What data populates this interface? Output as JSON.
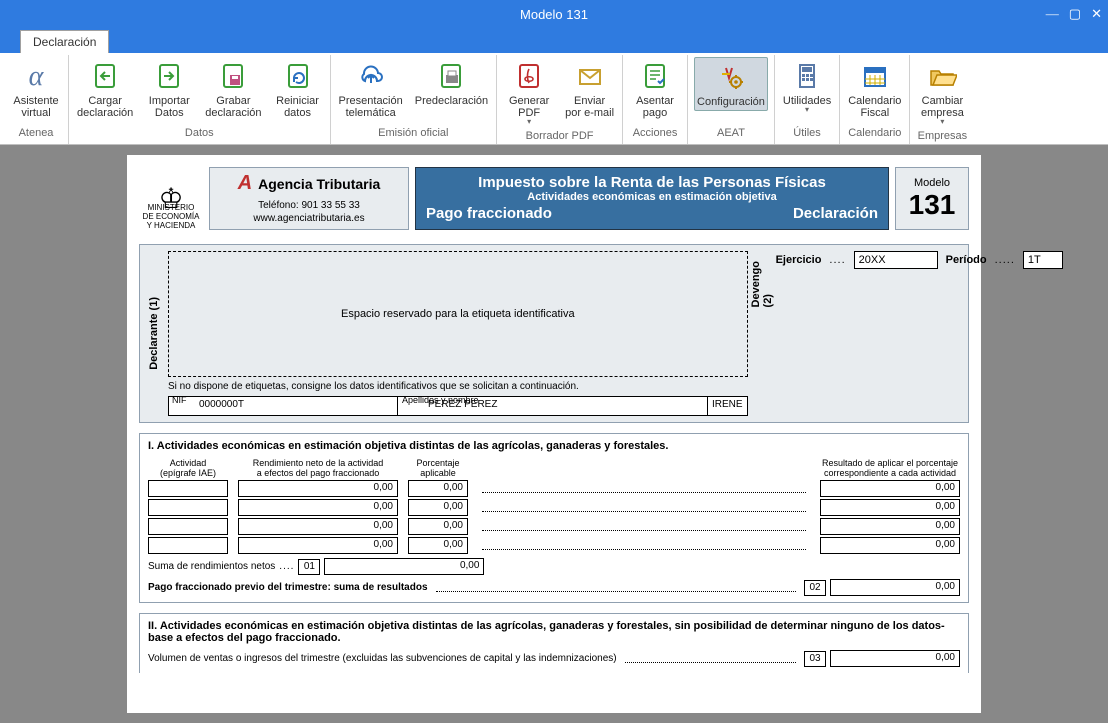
{
  "window": {
    "title": "Modelo 131"
  },
  "tab": {
    "label": "Declaración"
  },
  "ribbon": {
    "groups": [
      {
        "name": "Atenea",
        "items": [
          {
            "label": "Asistente\nvirtual"
          }
        ]
      },
      {
        "name": "Datos",
        "items": [
          {
            "label": "Cargar\ndeclaración"
          },
          {
            "label": "Importar\nDatos"
          },
          {
            "label": "Grabar\ndeclaración"
          },
          {
            "label": "Reiniciar\ndatos"
          }
        ]
      },
      {
        "name": "Emisión oficial",
        "items": [
          {
            "label": "Presentación\ntelemática"
          },
          {
            "label": "Predeclaración"
          }
        ]
      },
      {
        "name": "Borrador PDF",
        "items": [
          {
            "label": "Generar\nPDF",
            "caret": true
          },
          {
            "label": "Enviar\npor e-mail"
          }
        ]
      },
      {
        "name": "Acciones",
        "items": [
          {
            "label": "Asentar\npago"
          }
        ]
      },
      {
        "name": "AEAT",
        "items": [
          {
            "label": "Configuración",
            "active": true
          }
        ]
      },
      {
        "name": "Útiles",
        "items": [
          {
            "label": "Utilidades",
            "caret": true
          }
        ]
      },
      {
        "name": "Calendario",
        "items": [
          {
            "label": "Calendario\nFiscal"
          }
        ]
      },
      {
        "name": "Empresas",
        "items": [
          {
            "label": "Cambiar\nempresa",
            "caret": true
          }
        ]
      }
    ]
  },
  "header": {
    "ministerio": "MINISTERIO\nDE ECONOMÍA\nY HACIENDA",
    "agencia": "Agencia Tributaria",
    "telefono": "Teléfono: 901 33 55 33",
    "web": "www.agenciatributaria.es",
    "irpf_l1": "Impuesto sobre la Renta de las Personas Físicas",
    "irpf_l2": "Actividades económicas en estimación objetiva",
    "irpf_l3a": "Pago fraccionado",
    "irpf_l3b": "Declaración",
    "modelo_label": "Modelo",
    "modelo_num": "131"
  },
  "declarante": {
    "label": "Declarante (1)",
    "etiqueta": "Espacio reservado para la etiqueta identificativa",
    "nota": "Si no dispone de etiquetas, consigne los datos identificativos que se solicitan a continuación.",
    "nif_label": "NIF",
    "nif": "0000000T",
    "apell_label": "Apellidos y nombre",
    "apellidos": "PEREZ PEREZ",
    "nombre": "IRENE"
  },
  "devengo": {
    "label": "Devengo\n(2)",
    "ej_label": "Ejercicio",
    "ej": "20XX",
    "per_label": "Período",
    "per": "1T"
  },
  "sec1": {
    "title": "I.  Actividades económicas en estimación objetiva distintas de las agrícolas, ganaderas y forestales.",
    "col_actividad": "Actividad\n(epígrafe IAE)",
    "col_rend": "Rendimiento neto de la actividad\na efectos del pago fraccionado",
    "col_pct": "Porcentaje\naplicable",
    "col_res": "Resultado de aplicar el porcentaje\ncorrespondiente a cada actividad",
    "rows": [
      {
        "rend": "0,00",
        "pct": "0,00",
        "res": "0,00"
      },
      {
        "rend": "0,00",
        "pct": "0,00",
        "res": "0,00"
      },
      {
        "rend": "0,00",
        "pct": "0,00",
        "res": "0,00"
      },
      {
        "rend": "0,00",
        "pct": "0,00",
        "res": "0,00"
      }
    ],
    "suma_label": "Suma de rendimientos netos",
    "box01": "01",
    "suma_val": "0,00",
    "previo_label": "Pago fraccionado previo del trimestre: suma de resultados",
    "box02": "02",
    "previo_val": "0,00"
  },
  "sec2": {
    "title": "II.  Actividades económicas en estimación objetiva distintas de las agrícolas, ganaderas y forestales, sin posibilidad de determinar ninguno de los datos-base a efectos del pago fraccionado.",
    "vol_label": "Volumen de ventas o ingresos del trimestre (excluidas las subvenciones de capital y las indemnizaciones)",
    "box03": "03",
    "vol_val": "0,00"
  },
  "chart_data": {
    "type": "table",
    "title": "Modelo 131 — Pago fraccionado",
    "identificacion": {
      "nif": "0000000T",
      "apellidos": "PEREZ PEREZ",
      "nombre": "IRENE",
      "ejercicio": "20XX",
      "periodo": "1T"
    },
    "seccion_I": {
      "columns": [
        "Actividad (epígrafe IAE)",
        "Rendimiento neto",
        "Porcentaje aplicable",
        "Resultado"
      ],
      "rows": [
        [
          "",
          0.0,
          0.0,
          0.0
        ],
        [
          "",
          0.0,
          0.0,
          0.0
        ],
        [
          "",
          0.0,
          0.0,
          0.0
        ],
        [
          "",
          0.0,
          0.0,
          0.0
        ]
      ],
      "casilla_01_suma_rendimientos": 0.0,
      "casilla_02_pago_fraccionado_previo": 0.0
    },
    "seccion_II": {
      "casilla_03_volumen_ventas": 0.0
    }
  }
}
